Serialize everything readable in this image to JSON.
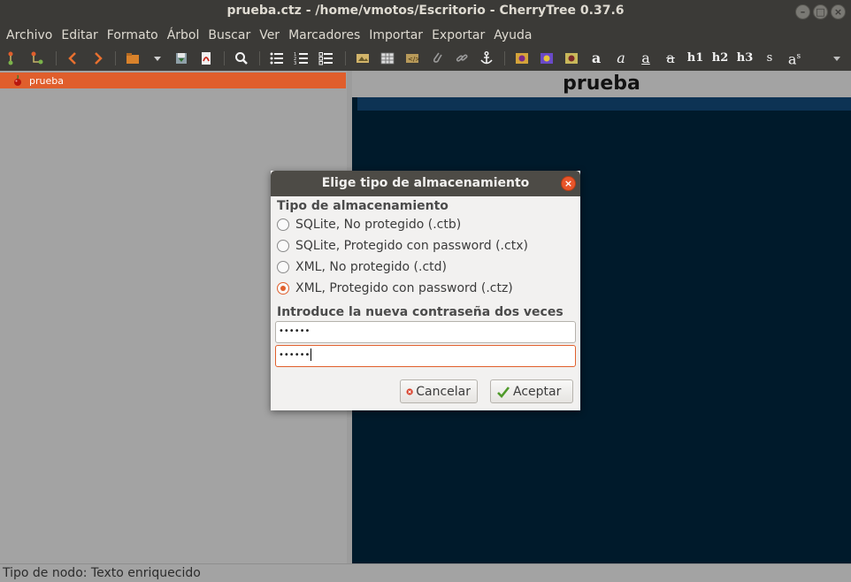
{
  "window": {
    "title": "prueba.ctz - /home/vmotos/Escritorio - CherryTree 0.37.6",
    "controls": [
      "minimize-icon",
      "maximize-icon",
      "close-icon"
    ]
  },
  "menubar": {
    "items": [
      "Archivo",
      "Editar",
      "Formato",
      "Árbol",
      "Buscar",
      "Ver",
      "Marcadores",
      "Importar",
      "Exportar",
      "Ayuda"
    ]
  },
  "toolbar": {
    "text_buttons": {
      "bold": "a",
      "italic": "a",
      "underline": "a",
      "strikethrough": "a",
      "h1": "h1",
      "h2": "h2",
      "h3": "h3",
      "small": "s",
      "superscript": "a",
      "superscript_sup": "s"
    }
  },
  "tree": {
    "nodes": [
      {
        "label": "prueba",
        "selected": true
      }
    ]
  },
  "editor": {
    "node_title": "prueba"
  },
  "statusbar": {
    "text": "Tipo de nodo: Texto enriquecido"
  },
  "dialog": {
    "title": "Elige tipo de almacenamiento",
    "storage_label": "Tipo de almacenamiento",
    "options": [
      {
        "label": "SQLite, No protegido (.ctb)",
        "checked": false
      },
      {
        "label": "SQLite, Protegido con password (.ctx)",
        "checked": false
      },
      {
        "label": "XML, No protegido (.ctd)",
        "checked": false
      },
      {
        "label": "XML, Protegido con password (.ctz)",
        "checked": true
      }
    ],
    "password_label": "Introduce la nueva contraseña dos veces",
    "password1": "••••••",
    "password2": "••••••",
    "cancel_label": "Cancelar",
    "accept_label": "Aceptar"
  },
  "colors": {
    "accent": "#e0602d",
    "editor_bg": "#001a2b",
    "chrome_dark": "#3b3a37",
    "panel_gray": "#a3a3a3"
  }
}
